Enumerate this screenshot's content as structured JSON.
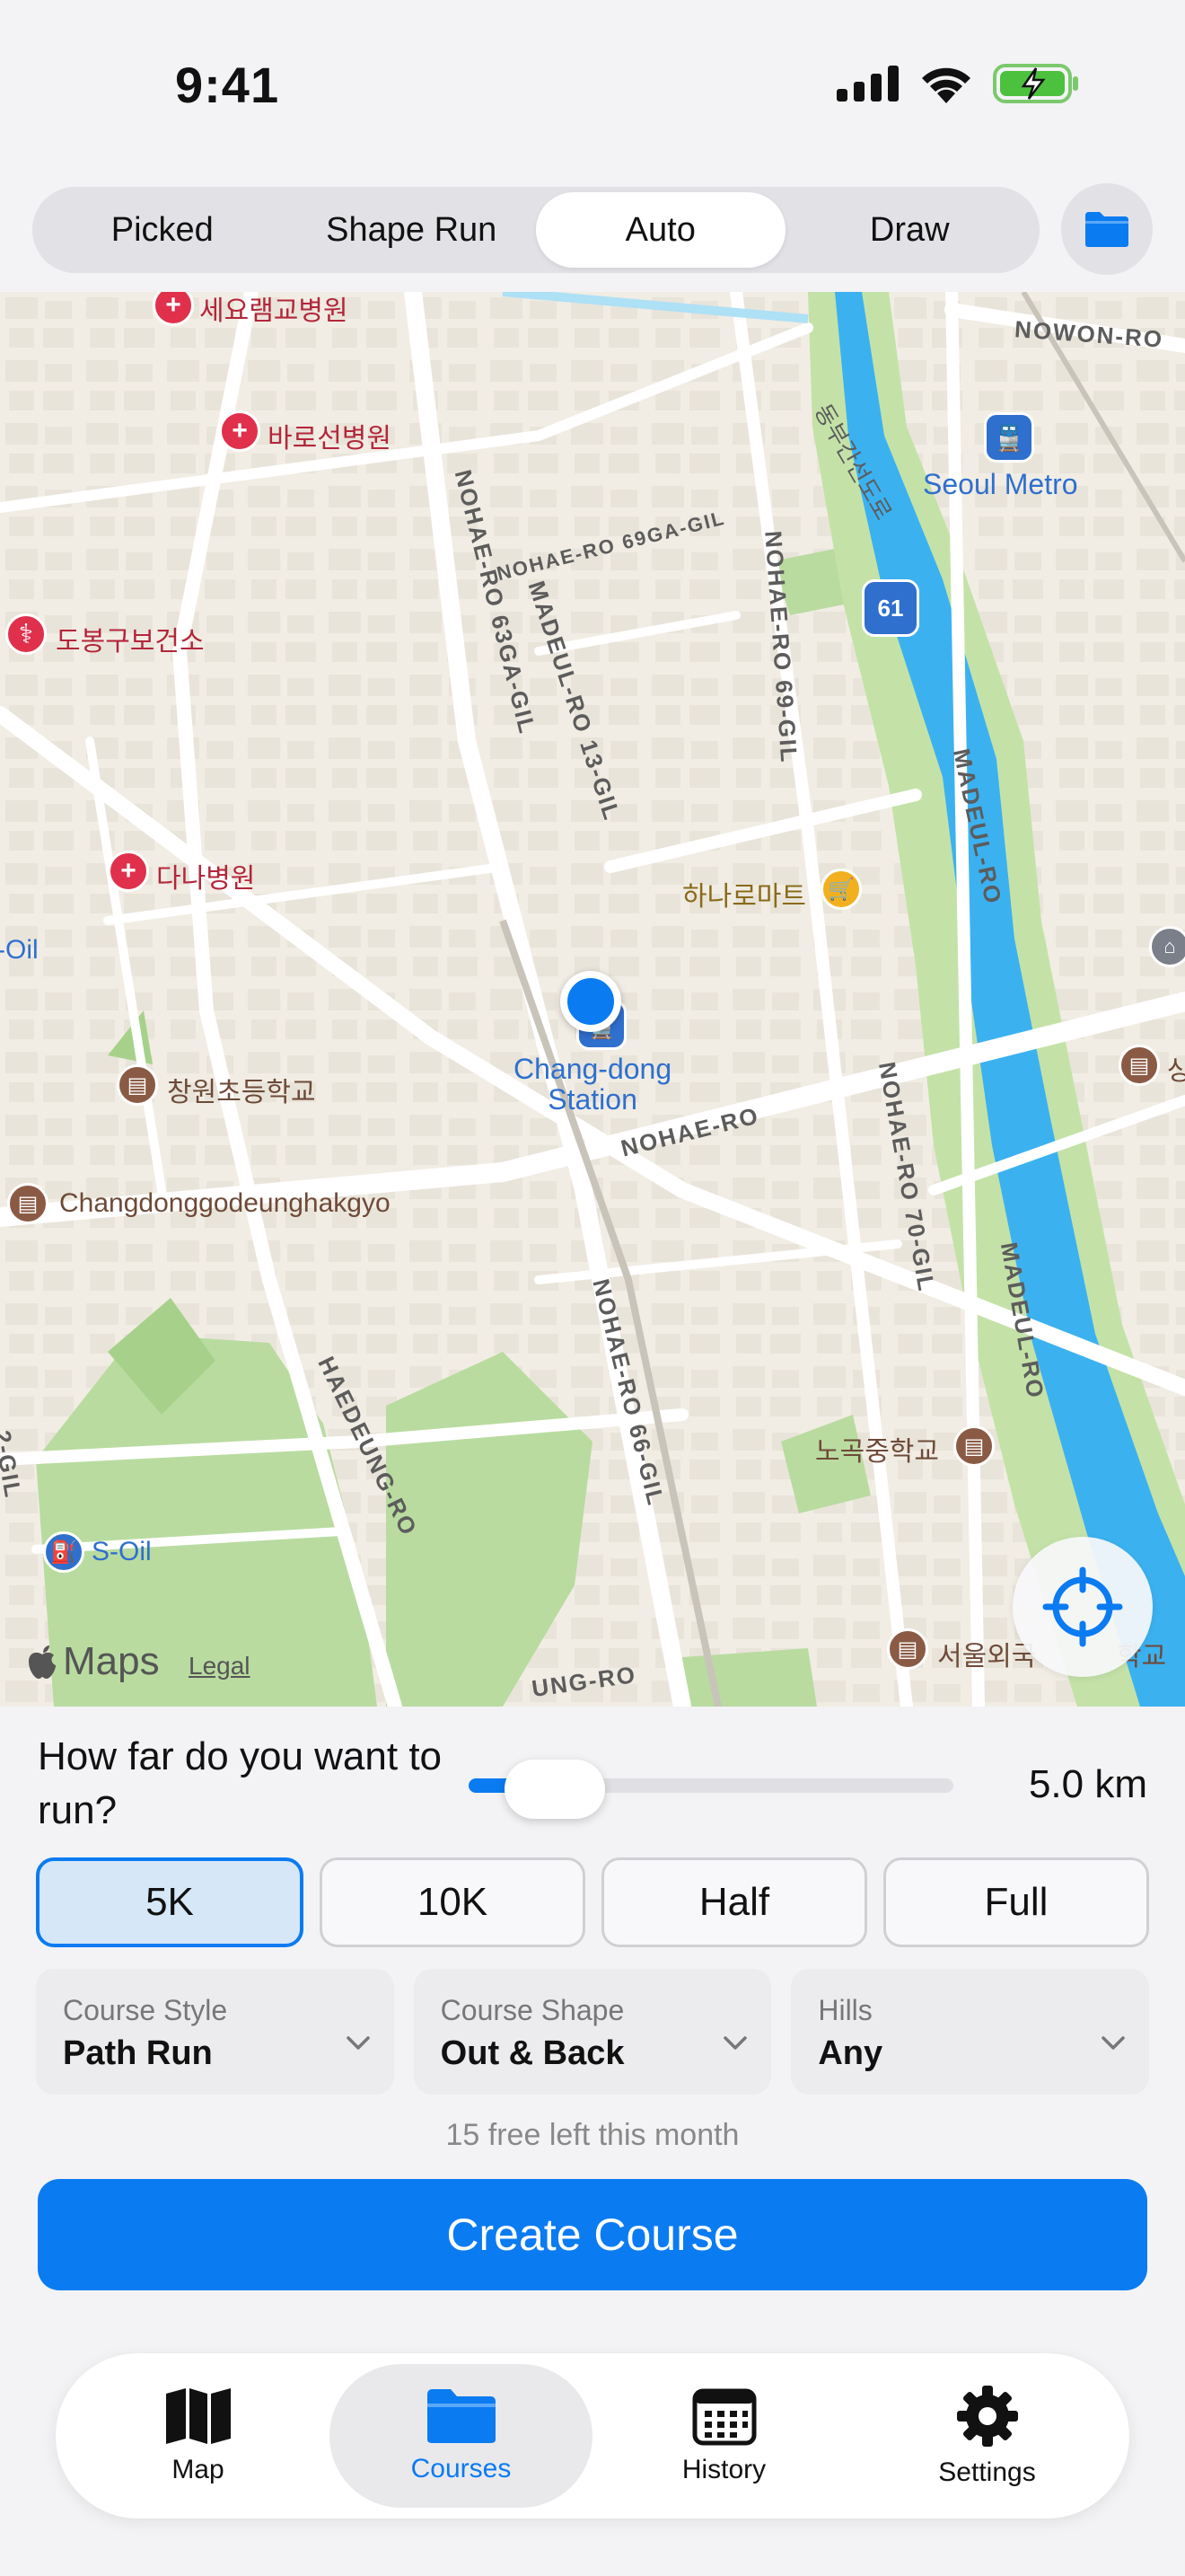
{
  "status_bar": {
    "time": "9:41"
  },
  "segments": [
    {
      "label": "Picked",
      "active": false
    },
    {
      "label": "Shape Run",
      "active": false
    },
    {
      "label": "Auto",
      "active": true
    },
    {
      "label": "Draw",
      "active": false
    }
  ],
  "folder_button_icon": "folder-icon",
  "map": {
    "labels": {
      "hospital_top": "세요램교병원",
      "baro_hospital": "바로선병원",
      "dobong_health": "도봉구보건소",
      "dana_hospital": "다나병원",
      "oil_left": "-Oil",
      "changwon_school": "창원초등학교",
      "changdong_school": "Changdonggodeunghakgyo",
      "s_oil": "S-Oil",
      "station": "Chang-dong\nStation",
      "hana_mart": "하나로마트",
      "seoul_metro": "Seoul Metro",
      "nowon_ro": "NOWON-RO",
      "dongbu_expressway": "동부간선도로",
      "route_61": "61",
      "nohae_69ga": "NOHAE-RO 69GA-GIL",
      "nohae_63ga": "NOHAE-RO 63GA-GIL",
      "madeul_13": "MADEUL-RO 13-GIL",
      "nohae_69": "NOHAE-RO 69-GIL",
      "madeul_ro_upper": "MADEUL-RO",
      "madeul_ro_lower": "MADEUL-RO",
      "nohae_ro": "NOHAE-RO",
      "nohae_70": "NOHAE-RO 70-GIL",
      "nohae_66": "NOHAE-RO 66-GIL",
      "haedeung_ro": "HAEDEUNG-RO",
      "nogok_school": "노곡중학교",
      "seoul_school": "서울외국",
      "ung_ro": "UNG-RO",
      "left_gil": "2-GIL",
      "right_edge_char": "상",
      "right_bottom_chars": "학교"
    },
    "maps_logo": "Maps",
    "legal": "Legal",
    "locate_icon": "crosshair-icon"
  },
  "distance": {
    "question": "How far do you want to run?",
    "value": "5.0 km",
    "slider_fraction": 0.1
  },
  "presets": [
    {
      "label": "5K",
      "active": true
    },
    {
      "label": "10K",
      "active": false
    },
    {
      "label": "Half",
      "active": false
    },
    {
      "label": "Full",
      "active": false
    }
  ],
  "selectors": [
    {
      "label": "Course Style",
      "value": "Path Run"
    },
    {
      "label": "Course Shape",
      "value": "Out & Back"
    },
    {
      "label": "Hills",
      "value": "Any"
    }
  ],
  "free_left": "15 free left this month",
  "create_button": "Create Course",
  "tabs": [
    {
      "label": "Map",
      "icon": "map-icon",
      "active": false
    },
    {
      "label": "Courses",
      "icon": "folder-icon",
      "active": true
    },
    {
      "label": "History",
      "icon": "calendar-icon",
      "active": false
    },
    {
      "label": "Settings",
      "icon": "gear-icon",
      "active": false
    }
  ],
  "colors": {
    "accent": "#0b7bf2",
    "map_land": "#f1ede4",
    "river": "#3cb1f0",
    "park": "#b9dba0"
  }
}
